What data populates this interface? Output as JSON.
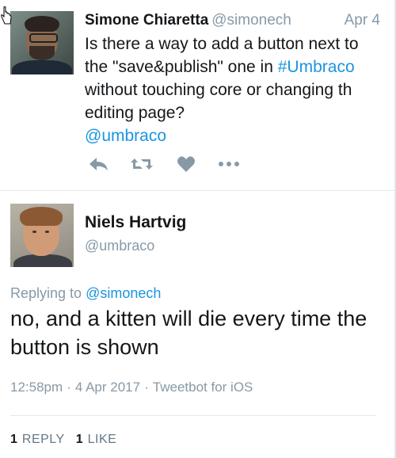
{
  "tweet1": {
    "name": "Simone Chiaretta",
    "handle": "@simonech",
    "date": "Apr 4",
    "text_before_hashtag": "Is there a way to add a button next to the \"save&publish\" one in ",
    "hashtag": "#Umbraco",
    "text_after_hashtag": " without touching core or changing th editing page?",
    "mention": "@umbraco",
    "actions": [
      "reply-icon",
      "retweet-icon",
      "like-icon",
      "more-icon"
    ]
  },
  "tweet2": {
    "name": "Niels Hartvig",
    "handle": "@umbraco",
    "replying_prefix": "Replying to ",
    "replying_to": "@simonech",
    "text": "no, and a kitten will die every time the button is shown",
    "time": "12:58pm",
    "separator": "·",
    "date": "4 Apr 2017",
    "source": "Tweetbot for iOS",
    "stats": {
      "replies_count": "1",
      "replies_label": "REPLY",
      "likes_count": "1",
      "likes_label": "LIKE"
    }
  },
  "colors": {
    "link": "#1b95e0",
    "muted": "#8899a6",
    "text": "#14171a",
    "divider": "#e1e8ed",
    "action_icon": "#8899a6"
  }
}
